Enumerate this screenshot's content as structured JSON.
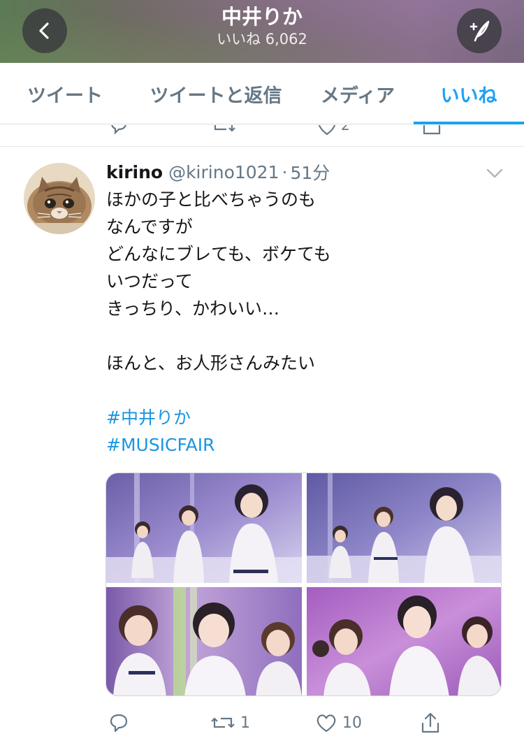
{
  "header": {
    "title": "中井りか",
    "subtitle": "いいね 6,062",
    "back_icon": "chevron-left-icon",
    "compose_icon": "compose-tweet-icon"
  },
  "tabs": [
    {
      "label": "ツイート",
      "active": false
    },
    {
      "label": "ツイートと返信",
      "active": false
    },
    {
      "label": "メディア",
      "active": false
    },
    {
      "label": "いいね",
      "active": true
    }
  ],
  "previous_tweet": {
    "like_count": "2"
  },
  "tweet": {
    "display_name": "kirino",
    "handle": "@kirino1021",
    "separator": "·",
    "time": "51分",
    "lines": [
      "ほかの子と比べちゃうのも",
      "なんですが",
      "どんなにブレても、ボケても",
      "いつだって",
      "きっちり、かわいい…",
      "",
      "ほんと、お人形さんみたい",
      ""
    ],
    "hashtags": [
      "#中井りか",
      "#MUSICFAIR"
    ],
    "actions": {
      "reply_count": "",
      "retweet_count": "1",
      "like_count": "10"
    }
  },
  "colors": {
    "accent": "#1da1f2",
    "hashtag": "#1b95e0",
    "muted": "#657786"
  }
}
